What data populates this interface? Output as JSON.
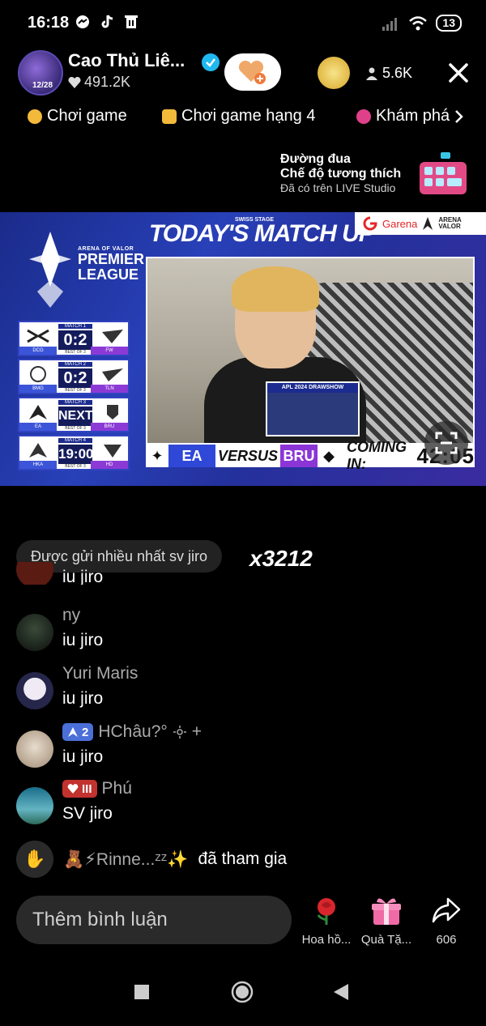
{
  "status_bar": {
    "time": "16:18",
    "battery": "13"
  },
  "header": {
    "host_name": "Cao Thủ Liê...",
    "likes": "491.2K",
    "avatar_badge": "12/28",
    "viewers": "5.6K"
  },
  "tabs": [
    {
      "label": "Chơi game",
      "color": "#f2b93b"
    },
    {
      "label": "Chơi game hạng 4",
      "color": "#f2b93b"
    },
    {
      "label": "Khám phá",
      "color": "#e0408a"
    }
  ],
  "promo": {
    "line1": "Đường đua",
    "line2": "Chế độ tương thích",
    "line3": "Đã có trên LIVE Studio"
  },
  "stream": {
    "league_small": "ARENA OF VALOR",
    "league_line1": "PREMIER",
    "league_line2": "LEAGUE",
    "headline": "TODAY'S MATCH UP",
    "headline_sub": "SWISS STAGE",
    "brand1": "Garena",
    "brand2_line1": "ARENA",
    "brand2_line2": "VALOR",
    "matches": [
      {
        "label": "MATCH 1",
        "score": "0:2",
        "bo": "BEST OF 3",
        "left": "DCG",
        "right": "FW"
      },
      {
        "label": "MATCH 2",
        "score": "0:2",
        "bo": "BEST OF 3",
        "left": "BMG",
        "right": "TLN"
      },
      {
        "label": "MATCH 3",
        "score": "NEXT",
        "bo": "BEST OF 3",
        "left": "EA",
        "right": "BRU"
      },
      {
        "label": "MATCH 4",
        "score": "19:00",
        "bo": "BEST OF 3",
        "left": "HKA",
        "right": "HD"
      }
    ],
    "pip_label": "APL 2024 DRAWSHOW",
    "team_left": "EA",
    "versus": "VERSUS",
    "team_right": "BRU",
    "coming_in": "COMING IN:",
    "countdown": "42:05"
  },
  "top_gift": {
    "label": "Được gửi nhiều nhất sv jiro",
    "count": "x3212"
  },
  "chat": [
    {
      "user": "",
      "text": "iu jiro",
      "avatar_color": "#5a1b12"
    },
    {
      "user": "ny",
      "text": "iu jiro",
      "avatar_color": "#1f2a1f"
    },
    {
      "user": "Yuri Maris",
      "text": "iu jiro",
      "avatar_color": "#d8d8e8"
    },
    {
      "user": "HChâu?°",
      "badge": "2",
      "text": "iu jiro",
      "avatar_color": "#c9b9a5"
    },
    {
      "user": "Phú",
      "badge": "III",
      "text": "SV jiro",
      "avatar_color": "#3a8a9a"
    }
  ],
  "join": {
    "user": "Rinne...",
    "action": "đã tham gia"
  },
  "bottom": {
    "comment_placeholder": "Thêm bình luận",
    "rose_label": "Hoa hồ...",
    "gift_label": "Quà Tặ...",
    "share_count": "606"
  }
}
